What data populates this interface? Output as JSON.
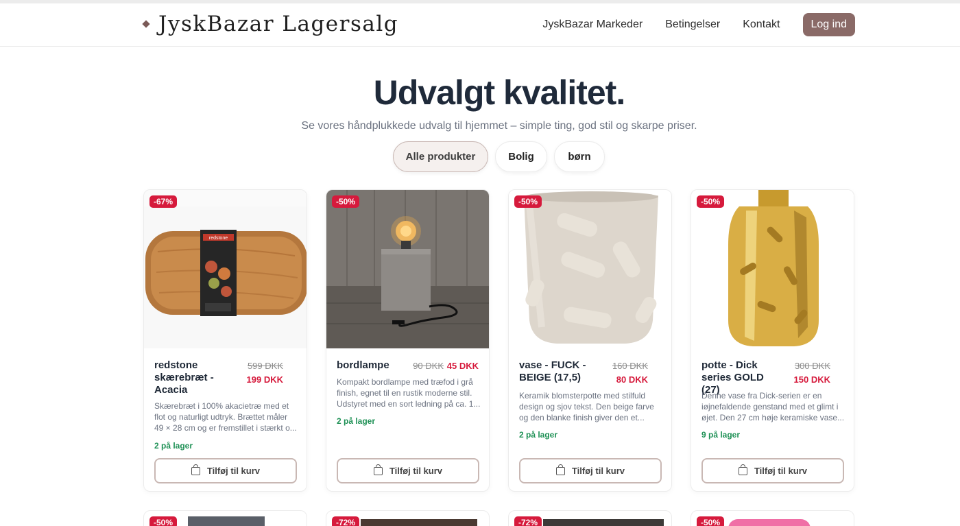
{
  "header": {
    "brand": "JyskBazar Lagersalg",
    "nav": [
      "JyskBazar Markeder",
      "Betingelser",
      "Kontakt"
    ],
    "login": "Log ind"
  },
  "hero": {
    "title": "Udvalgt kvalitet.",
    "subtitle": "Se vores håndplukkede udvalg til hjemmet – simple ting, god stil og skarpe priser."
  },
  "filters": [
    "Alle produkter",
    "Bolig",
    "børn"
  ],
  "cart_label": "Tilføj til kurv",
  "products": [
    {
      "discount": "-67%",
      "name": "redstone skærebræt - Acacia",
      "old_price": "599 DKK",
      "new_price": "199 DKK",
      "description": "Skærebræt i 100% akacietræ med et flot og naturligt udtryk. Brættet måler 49 × 28 cm og er fremstillet i stærkt o...",
      "stock": "2 på lager",
      "label_text": "redstone"
    },
    {
      "discount": "-50%",
      "name": "bordlampe",
      "old_price": "90 DKK",
      "new_price": "45 DKK",
      "description": "Kompakt bordlampe med træfod i grå finish, egnet til en rustik moderne stil. Udstyret med en sort ledning på ca. 1...",
      "stock": "2 på lager"
    },
    {
      "discount": "-50%",
      "name": "vase - FUCK - BEIGE (17,5)",
      "old_price": "160 DKK",
      "new_price": "80 DKK",
      "description": "Keramik blomsterpotte med stilfuld design og sjov tekst. Den beige farve og den blanke finish giver den et...",
      "stock": "2 på lager"
    },
    {
      "discount": "-50%",
      "name": "potte - Dick series GOLD (27)",
      "old_price": "300 DKK",
      "new_price": "150 DKK",
      "description": "Denne vase fra Dick-serien er en iøjnefaldende genstand med et glimt i øjet. Den 27 cm høje keramiske vase...",
      "stock": "9 på lager"
    }
  ],
  "next_row_badges": [
    "-50%",
    "-72%",
    "-72%",
    "-50%"
  ]
}
